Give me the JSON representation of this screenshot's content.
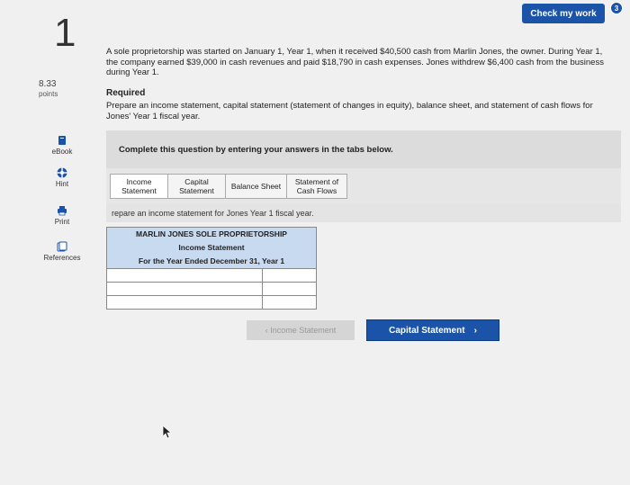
{
  "header": {
    "check_label": "Check my work",
    "check_badge": "3"
  },
  "question": {
    "number": "1",
    "points": "8.33",
    "points_label": "points"
  },
  "tools": [
    {
      "label": "eBook",
      "icon": "book-icon"
    },
    {
      "label": "Hint",
      "icon": "hint-icon"
    },
    {
      "label": "Print",
      "icon": "print-icon"
    },
    {
      "label": "References",
      "icon": "references-icon"
    }
  ],
  "prompt": "A sole proprietorship was started on January 1, Year 1, when it received $40,500 cash from Marlin Jones, the owner. During Year 1, the company earned $39,000 in cash revenues and paid $18,790 in cash expenses. Jones withdrew $6,400 cash from the business during Year 1.",
  "required": {
    "title": "Required",
    "text": "Prepare an income statement, capital statement (statement of changes in equity), balance sheet, and statement of cash flows for Jones' Year 1 fiscal year."
  },
  "complete_text": "Complete this question by entering your answers in the tabs below.",
  "tabs": [
    {
      "label": "Income Statement"
    },
    {
      "label": "Capital Statement"
    },
    {
      "label": "Balance Sheet"
    },
    {
      "label": "Statement of Cash Flows"
    }
  ],
  "instruction": "repare an income statement for Jones Year 1 fiscal year.",
  "statement": {
    "company": "MARLIN JONES SOLE PROPRIETORSHIP",
    "title": "Income Statement",
    "period": "For the Year Ended December 31, Year 1"
  },
  "nav": {
    "prev_label": "‹  Income Statement",
    "next_label": "Capital Statement",
    "next_chevron": "›"
  },
  "colors": {
    "primary": "#1a53a8",
    "statement_header": "#c8daf0"
  }
}
